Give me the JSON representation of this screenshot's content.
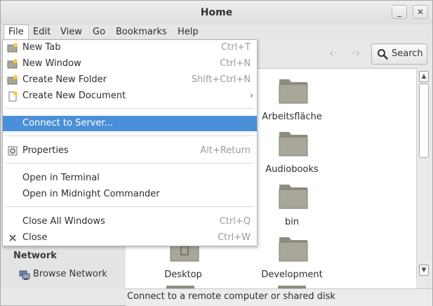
{
  "window": {
    "title": "Home",
    "minimize_glyph": "_",
    "close_glyph": "✕"
  },
  "menubar": {
    "items": [
      "File",
      "Edit",
      "View",
      "Go",
      "Bookmarks",
      "Help"
    ]
  },
  "toolbar": {
    "back_glyph": "‹·",
    "forward_glyph": "·›",
    "search_label": "Search",
    "search_icon": "search-icon"
  },
  "file_menu": {
    "items": [
      {
        "label": "New Tab",
        "accel": "Ctrl+T",
        "icon": "new-tab-icon"
      },
      {
        "label": "New Window",
        "accel": "Ctrl+N",
        "icon": "new-window-icon"
      },
      {
        "label": "Create New Folder",
        "accel": "Shift+Ctrl+N",
        "icon": "new-folder-icon"
      },
      {
        "label": "Create New Document",
        "accel": "",
        "icon": "new-document-icon",
        "submenu": "›"
      },
      {
        "label": "Connect to Server...",
        "accel": "",
        "selected": true
      },
      {
        "label": "Properties",
        "accel": "Alt+Return",
        "icon": "properties-icon"
      },
      {
        "label": "Open in Terminal",
        "accel": ""
      },
      {
        "label": "Open in Midnight Commander",
        "accel": ""
      },
      {
        "label": "Close All Windows",
        "accel": "Ctrl+Q"
      },
      {
        "label": "Close",
        "accel": "Ctrl+W",
        "icon": "close-icon"
      }
    ]
  },
  "sidebar": {
    "network_heading": "Network",
    "browse_network": "Browse Network"
  },
  "files": {
    "items": [
      {
        "name": "Arbeitsfläche"
      },
      {
        "name": "Audiobooks"
      },
      {
        "name": "bin"
      },
      {
        "name": "Desktop"
      },
      {
        "name": "Development"
      }
    ]
  },
  "status": {
    "text": "Connect to a remote computer or shared disk"
  },
  "colors": {
    "selection": "#4a90d9",
    "folder": "#a9a79a"
  }
}
